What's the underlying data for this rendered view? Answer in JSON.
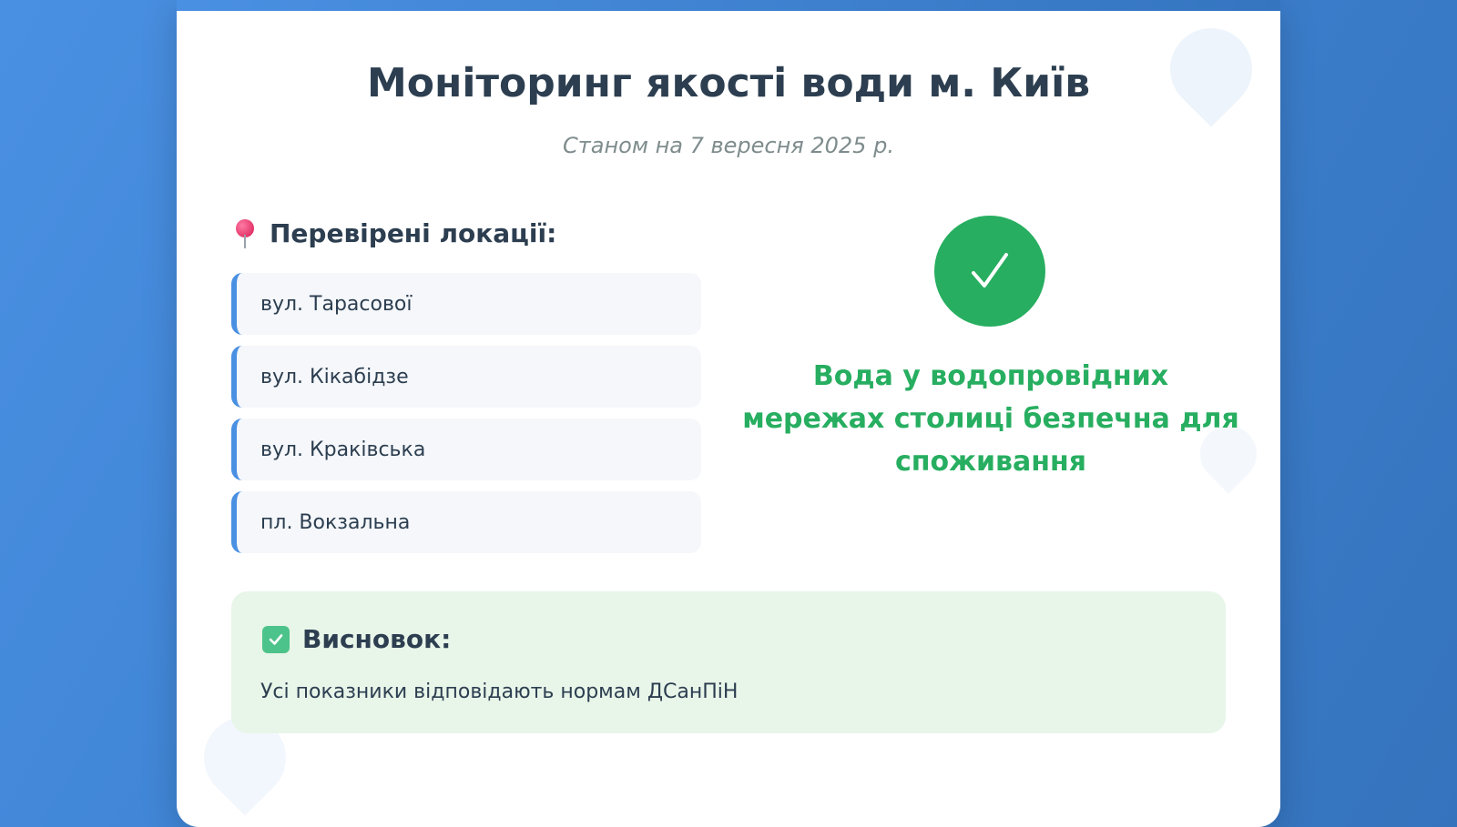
{
  "header": {
    "title": "Моніторинг якості води м. Київ",
    "subtitle": "Станом на 7 вересня 2025 р."
  },
  "locations": {
    "heading": "Перевірені локації:",
    "icon": "pin-icon",
    "items": [
      {
        "label": "вул. Тарасової"
      },
      {
        "label": "вул. Кікабідзе"
      },
      {
        "label": "вул. Краківська"
      },
      {
        "label": "пл. Вокзальна"
      }
    ]
  },
  "status": {
    "icon": "checkmark-icon",
    "color": "#27ae60",
    "message": "Вода у водопровідних мережах столиці безпечна для споживання"
  },
  "conclusion": {
    "icon": "check-box-icon",
    "heading": "Висновок:",
    "text": "Усі показники відповідають нормам ДСанПіН"
  },
  "colors": {
    "accent": "#4a90e2",
    "success": "#27ae60",
    "text": "#2c3e50",
    "muted": "#7f8c8d"
  }
}
